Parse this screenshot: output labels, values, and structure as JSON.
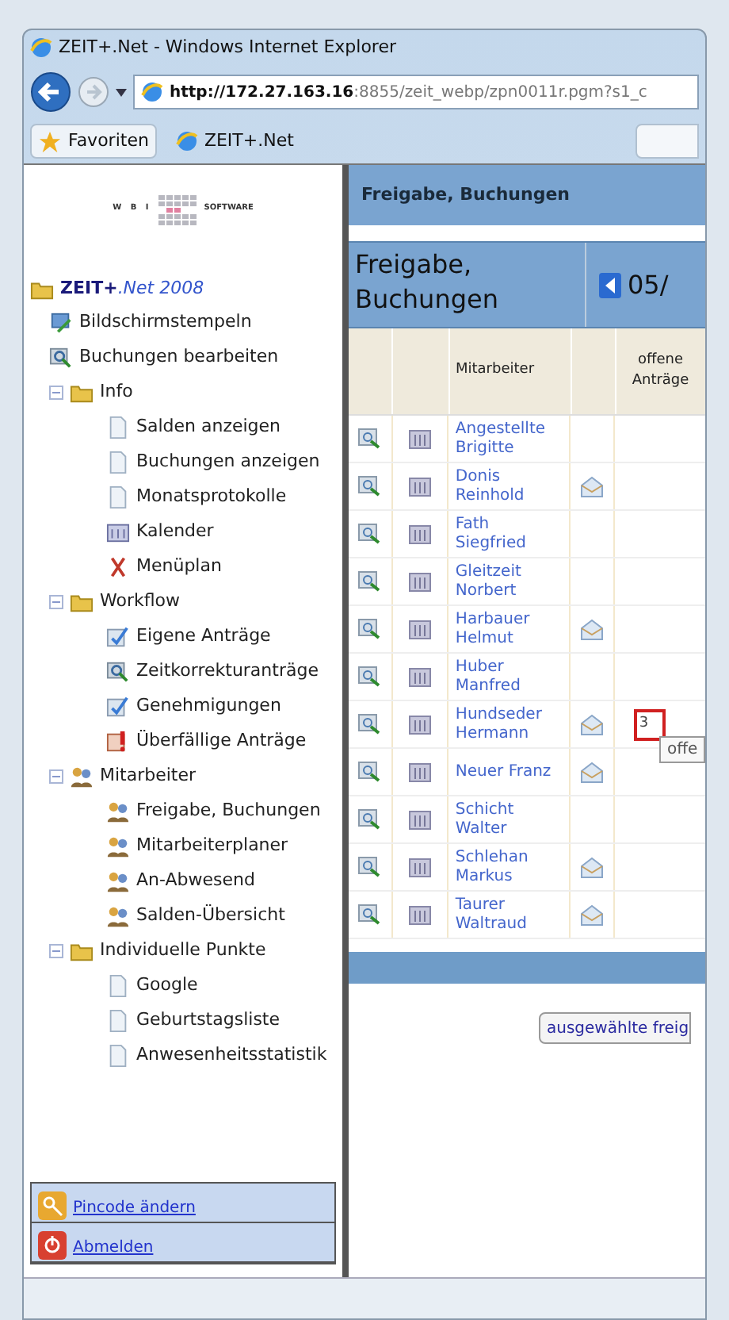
{
  "window": {
    "title": "ZEIT+.Net - Windows Internet Explorer"
  },
  "address": {
    "host": "http://172.27.163.16",
    "rest": ":8855/zeit_webp/zpn0011r.pgm?s1_c"
  },
  "favorites": {
    "label": "Favoriten",
    "tab": "ZEIT+.Net"
  },
  "sidebar": {
    "logo_left": "W B I",
    "logo_right": "SOFTWARE",
    "root": {
      "label": "ZEIT+",
      "suffix": ".Net 2008"
    },
    "tree": [
      {
        "kind": "stamp",
        "label": "Bildschirmstempeln"
      },
      {
        "kind": "edit",
        "label": "Buchungen bearbeiten"
      },
      {
        "kind": "folder",
        "label": "Info",
        "expanded": true,
        "children": [
          {
            "kind": "doc",
            "label": "Salden anzeigen"
          },
          {
            "kind": "doc",
            "label": "Buchungen anzeigen"
          },
          {
            "kind": "doc",
            "label": "Monatsprotokolle"
          },
          {
            "kind": "calendar",
            "label": "Kalender"
          },
          {
            "kind": "menu",
            "label": "Menüplan"
          }
        ]
      },
      {
        "kind": "folder",
        "label": "Workflow",
        "expanded": true,
        "children": [
          {
            "kind": "request",
            "label": "Eigene Anträge"
          },
          {
            "kind": "edit",
            "label": "Zeitkorrekturanträge"
          },
          {
            "kind": "request",
            "label": "Genehmigungen"
          },
          {
            "kind": "overdue",
            "label": "Überfällige Anträge"
          }
        ]
      },
      {
        "kind": "people",
        "label": "Mitarbeiter",
        "expanded": true,
        "children": [
          {
            "kind": "people",
            "label": "Freigabe, Buchungen"
          },
          {
            "kind": "people",
            "label": "Mitarbeiterplaner"
          },
          {
            "kind": "people",
            "label": "An-Abwesend"
          },
          {
            "kind": "people",
            "label": "Salden-Übersicht"
          }
        ]
      },
      {
        "kind": "folder",
        "label": "Individuelle Punkte",
        "expanded": true,
        "children": [
          {
            "kind": "doc",
            "label": "Google"
          },
          {
            "kind": "doc",
            "label": "Geburtstagsliste"
          },
          {
            "kind": "doc",
            "label": "Anwesenheitsstatistik"
          }
        ]
      }
    ],
    "bottom_links": [
      {
        "kind": "key",
        "label": "Pincode ändern"
      },
      {
        "kind": "logout",
        "label": "Abmelden"
      }
    ]
  },
  "main": {
    "header": "Freigabe, Buchungen",
    "title": "Freigabe, Buchungen",
    "period": "05/",
    "column_header": "Mitarbeiter",
    "open_header": "offene Anträge",
    "rows": [
      {
        "name": "Angestellte Brigitte",
        "mail": false
      },
      {
        "name": "Donis Reinhold",
        "mail": true
      },
      {
        "name": "Fath Siegfried",
        "mail": false
      },
      {
        "name": "Gleitzeit Norbert",
        "mail": false
      },
      {
        "name": "Harbauer Helmut",
        "mail": true
      },
      {
        "name": "Huber Manfred",
        "mail": false
      },
      {
        "name": "Hundseder Hermann",
        "mail": true,
        "open": "3",
        "tooltip": "offe"
      },
      {
        "name": "Neuer Franz",
        "mail": true
      },
      {
        "name": "Schicht Walter",
        "mail": false
      },
      {
        "name": "Schlehan Markus",
        "mail": true
      },
      {
        "name": "Taurer Waltraud",
        "mail": true
      }
    ],
    "button": "ausgewählte freig"
  }
}
